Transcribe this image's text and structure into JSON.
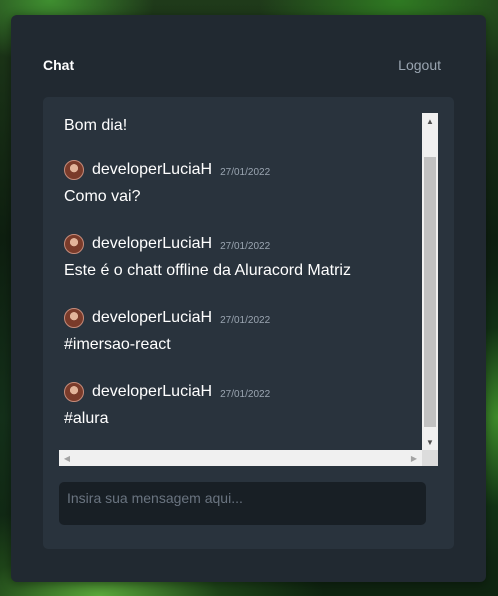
{
  "header": {
    "title": "Chat",
    "logout_label": "Logout"
  },
  "messages": {
    "first_text": "Bom dia!",
    "items": [
      {
        "username": "developerLuciaH",
        "date": "27/01/2022",
        "text": "Como vai?"
      },
      {
        "username": "developerLuciaH",
        "date": "27/01/2022",
        "text": "Este é o chatt offline da Aluracord Matriz"
      },
      {
        "username": "developerLuciaH",
        "date": "27/01/2022",
        "text": "#imersao-react"
      },
      {
        "username": "developerLuciaH",
        "date": "27/01/2022",
        "text": "#alura"
      }
    ]
  },
  "composer": {
    "placeholder": "Insira sua mensagem aqui..."
  },
  "colors": {
    "container_bg": "#212931",
    "panel_bg": "#29333d",
    "input_bg": "#181f25",
    "text": "#ffffff",
    "muted": "#9aa5b1"
  },
  "icons": {
    "scroll_up": "triangle-up",
    "scroll_down": "triangle-down",
    "scroll_left": "triangle-left",
    "scroll_right": "triangle-right"
  }
}
